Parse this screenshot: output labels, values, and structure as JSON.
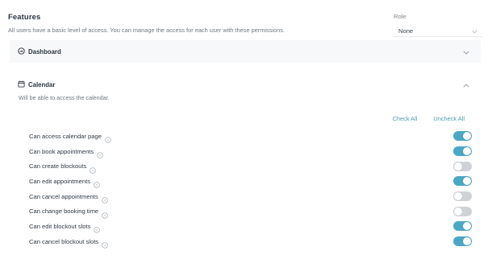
{
  "header": {
    "title": "Features",
    "description": "All users have a basic level of access. You can manage the access for each user with these permissions."
  },
  "role": {
    "label": "Role",
    "value": "None"
  },
  "sections": {
    "dashboard": {
      "title": "Dashboard",
      "icon": "dashboard-gauge-icon",
      "expanded": false
    },
    "calendar": {
      "title": "Calendar",
      "description": "Will be able to access the calendar.",
      "icon": "calendar-icon",
      "expanded": true
    }
  },
  "actions": {
    "check_all": "Check All",
    "uncheck_all": "Uncheck All"
  },
  "permissions": [
    {
      "label": "Can access calendar page",
      "enabled": true
    },
    {
      "label": "Can book appointments",
      "enabled": true
    },
    {
      "label": "Can create blockouts",
      "enabled": false
    },
    {
      "label": "Can edit appointments",
      "enabled": true
    },
    {
      "label": "Can cancel appointments",
      "enabled": false
    },
    {
      "label": "Can change booking time",
      "enabled": false
    },
    {
      "label": "Can edit blockout slots",
      "enabled": true
    },
    {
      "label": "Can cancel blockout slots",
      "enabled": true
    }
  ],
  "colors": {
    "accent": "#4aa8c4",
    "toggle_off": "#cfd3d7",
    "link": "#4f9db5"
  }
}
